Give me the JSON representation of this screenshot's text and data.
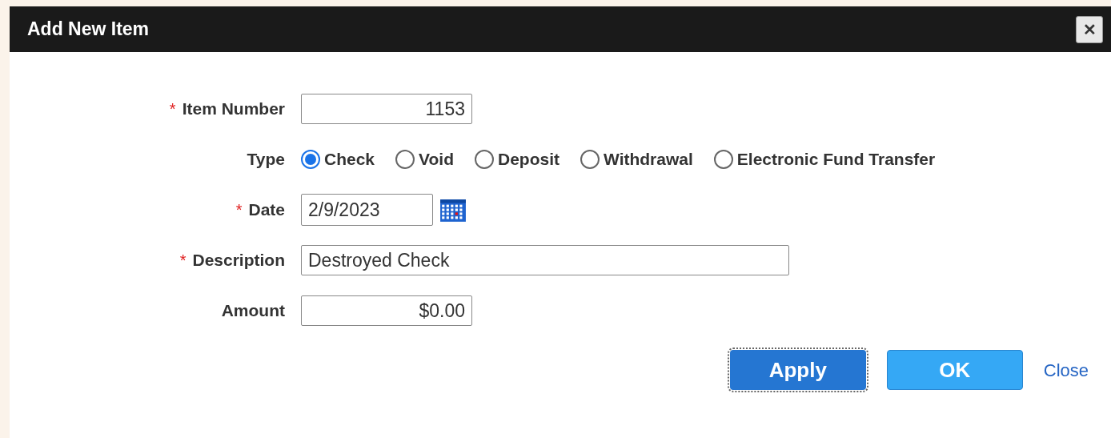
{
  "dialog": {
    "title": "Add New Item",
    "close_symbol": "✕"
  },
  "fields": [
    {
      "kind": "number",
      "label": "Item Number",
      "required_mark": "*",
      "value": "1153"
    },
    {
      "kind": "radio",
      "label": "Type",
      "options": [
        {
          "label": "Check",
          "selected": true
        },
        {
          "label": "Void",
          "selected": false
        },
        {
          "label": "Deposit",
          "selected": false
        },
        {
          "label": "Withdrawal",
          "selected": false
        },
        {
          "label": "Electronic Fund Transfer",
          "selected": false
        }
      ]
    },
    {
      "kind": "date",
      "label": "Date",
      "required_mark": "*",
      "value": "2/9/2023"
    },
    {
      "kind": "text",
      "label": "Description",
      "required_mark": "*",
      "value": "Destroyed Check"
    },
    {
      "kind": "number",
      "label": "Amount",
      "value": "$0.00"
    }
  ],
  "buttons": [
    {
      "label": "Apply",
      "focused": true
    },
    {
      "label": "OK",
      "focused": false
    }
  ],
  "close_link": "Close"
}
